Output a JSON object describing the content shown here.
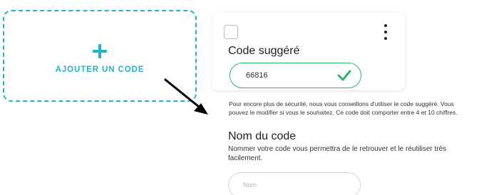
{
  "add_tile": {
    "label": "AJOUTER UN CODE",
    "accent_color": "#23b3c8"
  },
  "card": {
    "title": "Code suggéré",
    "code_value": "66816",
    "valid_color": "#2bb56a"
  },
  "helper": {
    "text": "Pour encore plus de sécurité, nous vous conseillons d'utiliser le code suggéré. Vous pouvez le modifier si vous le souhaitez. Ce code doit comporter entre 4 et 10 chiffres."
  },
  "name_section": {
    "title": "Nom du code",
    "description": "Nommer votre code vous permettra de le retrouver et le réutiliser très facilement.",
    "placeholder": "Nom"
  },
  "icons": [
    "plus-icon",
    "checkbox",
    "more-vertical-icon",
    "checkmark-icon",
    "arrow-icon"
  ]
}
